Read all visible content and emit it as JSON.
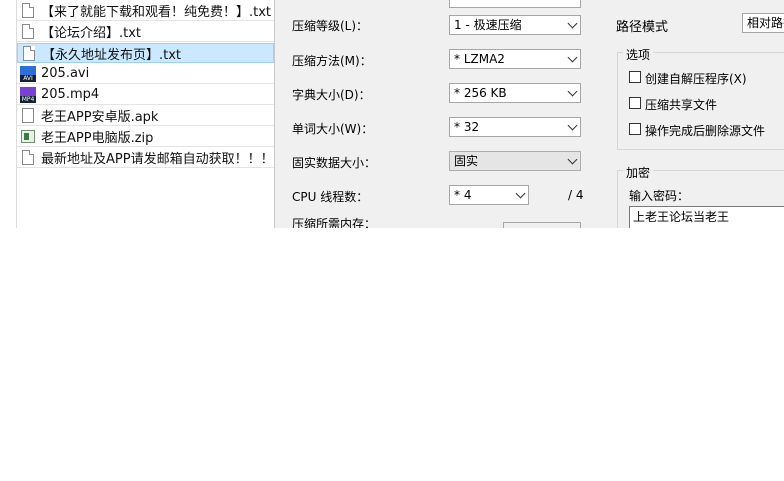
{
  "files": [
    {
      "name": "【来了就能下载和观看！纯免费！】.txt",
      "icon": "text-file-icon",
      "type": "txt",
      "selected": false
    },
    {
      "name": "【论坛介绍】.txt",
      "icon": "text-file-icon",
      "type": "txt",
      "selected": false
    },
    {
      "name": "【永久地址发布页】.txt",
      "icon": "text-file-icon",
      "type": "txt",
      "selected": true
    },
    {
      "name": "205.avi",
      "icon": "avi-video-icon",
      "type": "avi",
      "badge": "AVI",
      "selected": false
    },
    {
      "name": "205.mp4",
      "icon": "mp4-video-icon",
      "type": "mp4",
      "badge": "MP4",
      "selected": false
    },
    {
      "name": "老王APP安卓版.apk",
      "icon": "apk-file-icon",
      "type": "apk",
      "selected": false
    },
    {
      "name": "老王APP电脑版.zip",
      "icon": "zip-archive-icon",
      "type": "zip",
      "selected": false
    },
    {
      "name": "最新地址及APP请发邮箱自动获取！！！....",
      "icon": "text-file-icon",
      "type": "txt",
      "selected": false
    }
  ],
  "settings": {
    "level_label": "压缩等级(L)：",
    "level_value": "1 - 极速压缩",
    "method_label": "压缩方法(M)：",
    "method_value": "* LZMA2",
    "dict_label": "字典大小(D)：",
    "dict_value": "* 256 KB",
    "word_label": "单词大小(W)：",
    "word_value": "* 32",
    "solid_label": "固实数据大小：",
    "solid_value": "固实",
    "cpu_label": "CPU 线程数：",
    "cpu_value": "* 4",
    "cpu_total": "/ 4",
    "memory_label": "压缩所需内存："
  },
  "path": {
    "label": "路径模式",
    "value": "相对路径"
  },
  "options": {
    "title": "选项",
    "sfx": "创建自解压程序(X)",
    "shared": "压缩共享文件",
    "delete": "操作完成后删除源文件"
  },
  "encryption": {
    "title": "加密",
    "password_label": "输入密码：",
    "password_value": "上老王论坛当老王"
  }
}
